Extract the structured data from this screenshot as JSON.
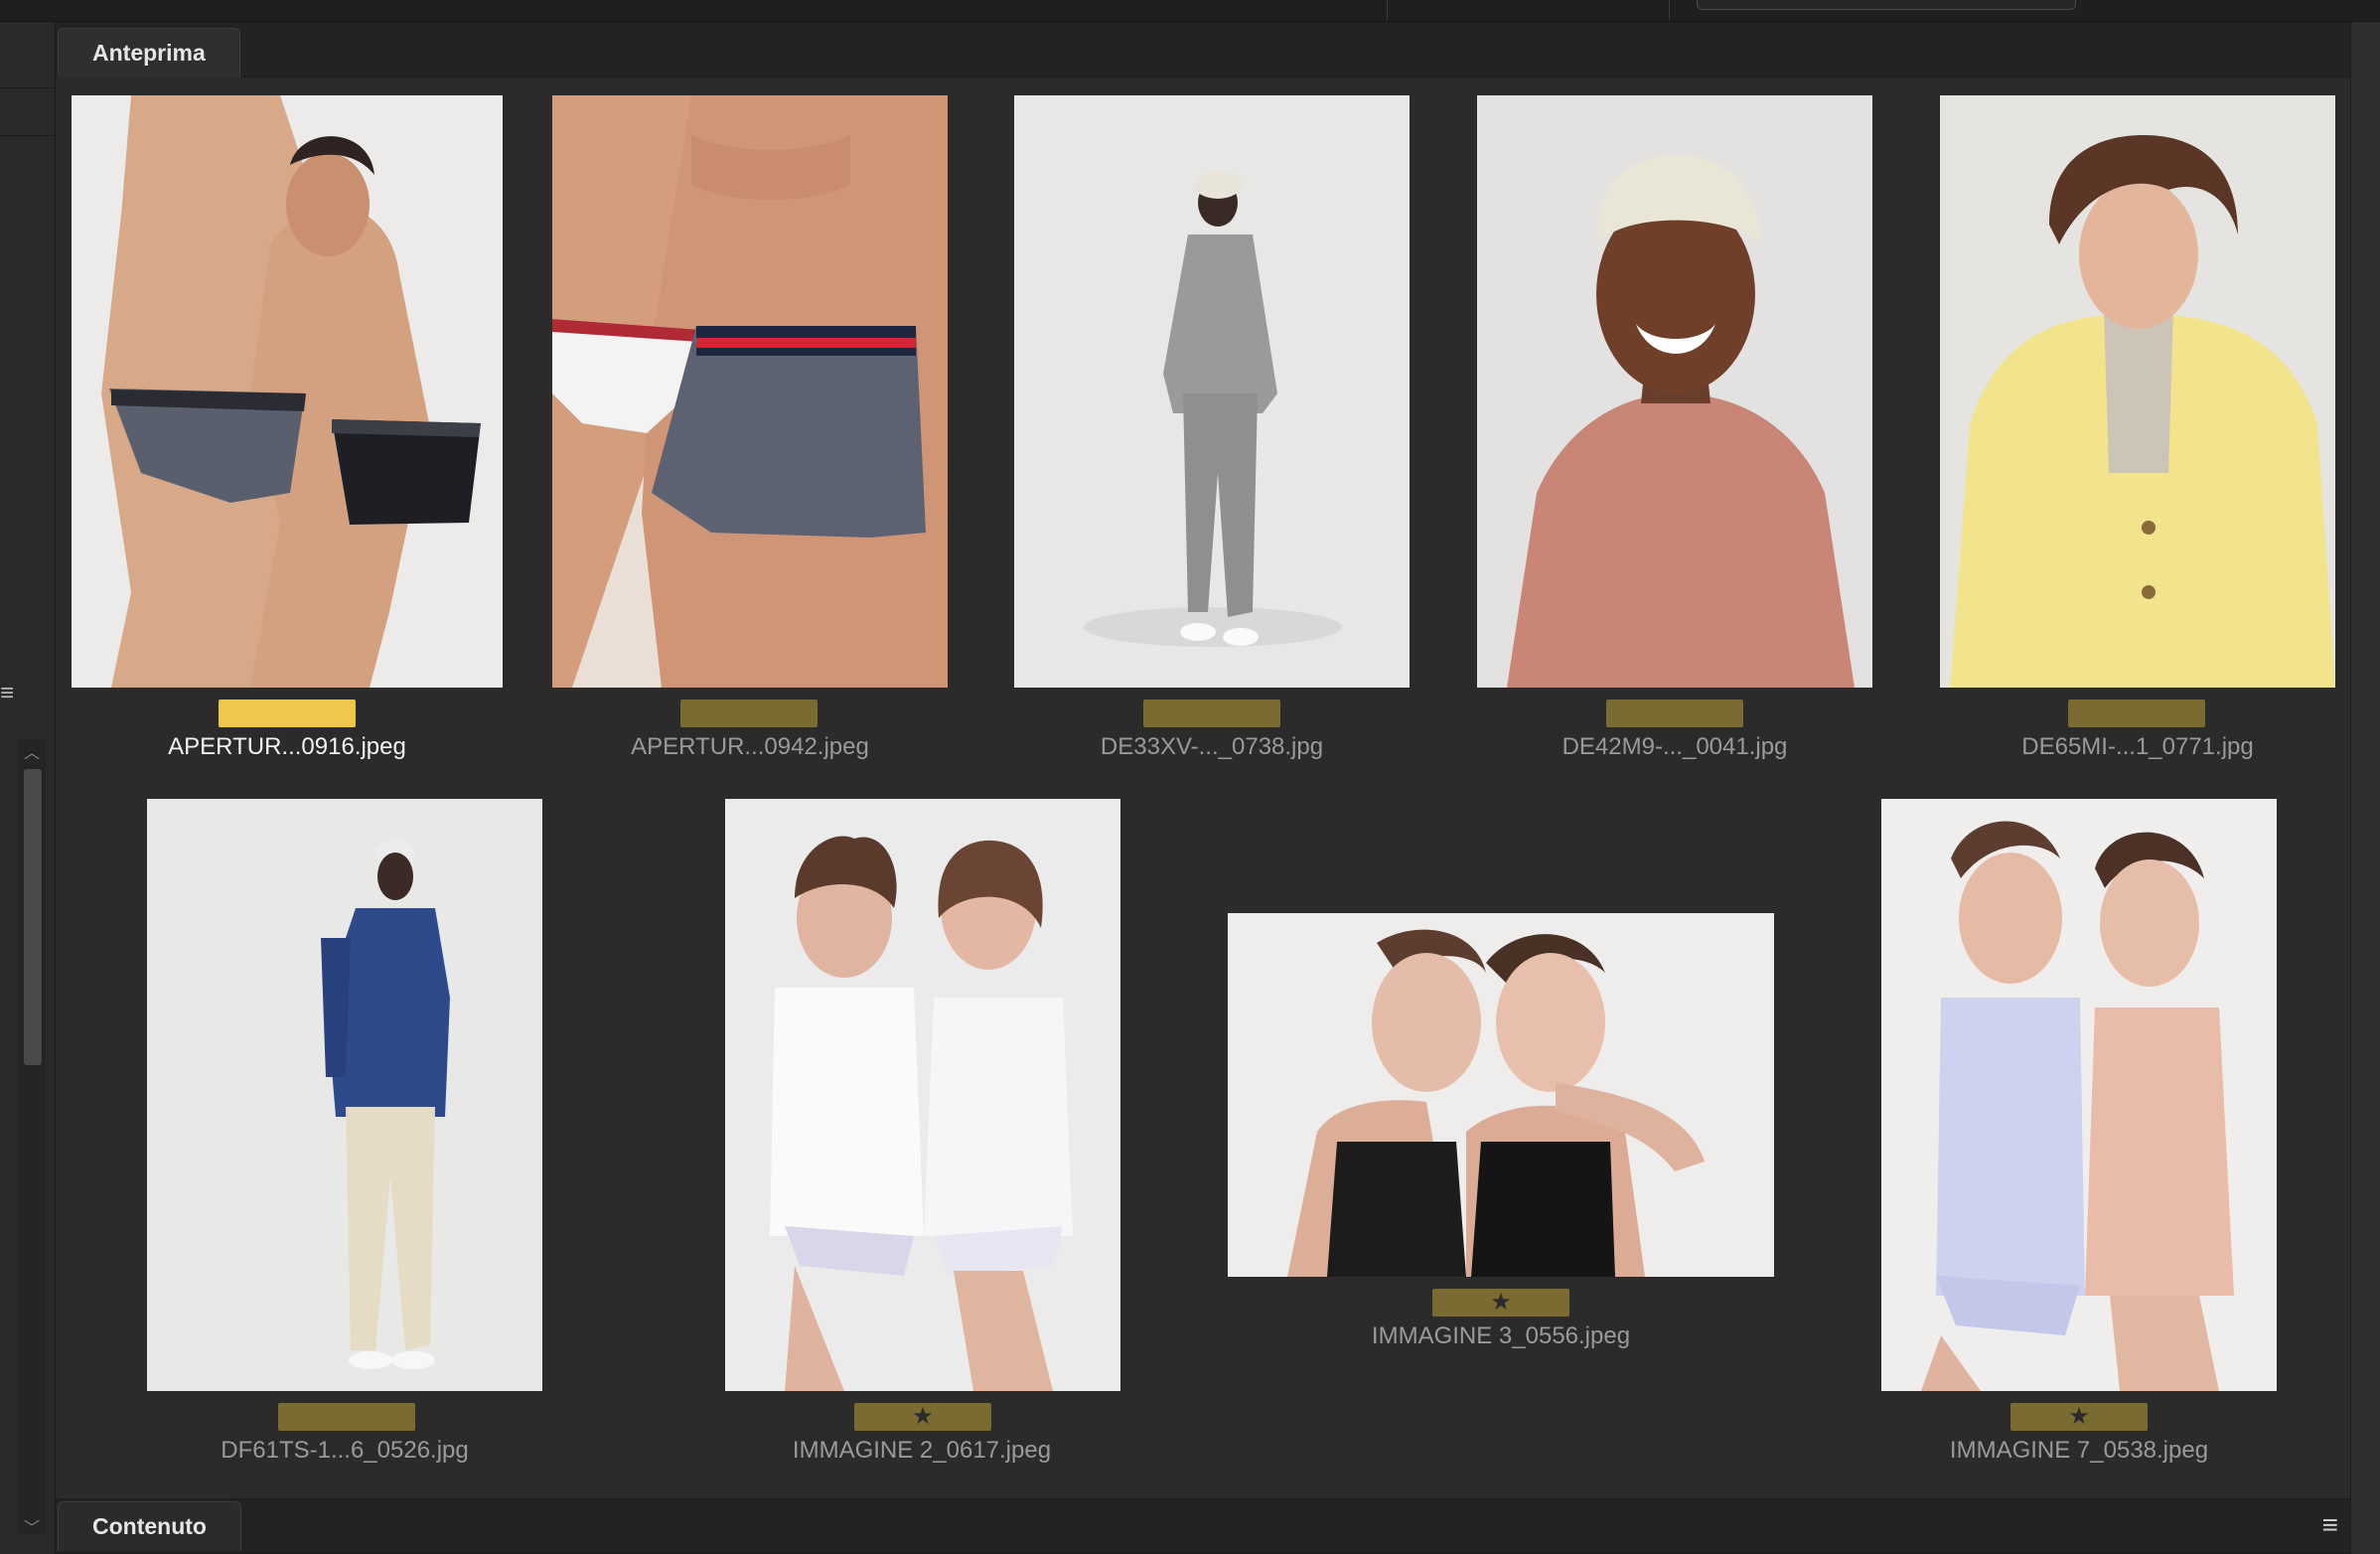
{
  "panels": {
    "preview_tab": "Anteprima",
    "content_tab": "Contenuto"
  },
  "thumbnails": [
    {
      "filename": "APERTUR...0916.jpeg",
      "rating": "",
      "selected": true
    },
    {
      "filename": "APERTUR...0942.jpeg",
      "rating": "",
      "selected": false
    },
    {
      "filename": "DE33XV-..._0738.jpg",
      "rating": "",
      "selected": false
    },
    {
      "filename": "DE42M9-..._0041.jpg",
      "rating": "",
      "selected": false
    },
    {
      "filename": "DE65MI-...1_0771.jpg",
      "rating": "",
      "selected": false
    },
    {
      "filename": "DF61TS-1...6_0526.jpg",
      "rating": "",
      "selected": false
    },
    {
      "filename": "IMMAGINE 2_0617.jpeg",
      "rating": "★",
      "selected": false
    },
    {
      "filename": "IMMAGINE 3_0556.jpeg",
      "rating": "★",
      "selected": false
    },
    {
      "filename": "IMMAGINE 7_0538.jpeg",
      "rating": "★",
      "selected": false
    }
  ],
  "colors": {
    "label_selected": "#efc74b",
    "label_default": "#7a6b31",
    "panel_bg": "#2b2b2b"
  },
  "icons": {
    "panel_menu": "hamburger-menu-icon",
    "star": "star-icon"
  }
}
